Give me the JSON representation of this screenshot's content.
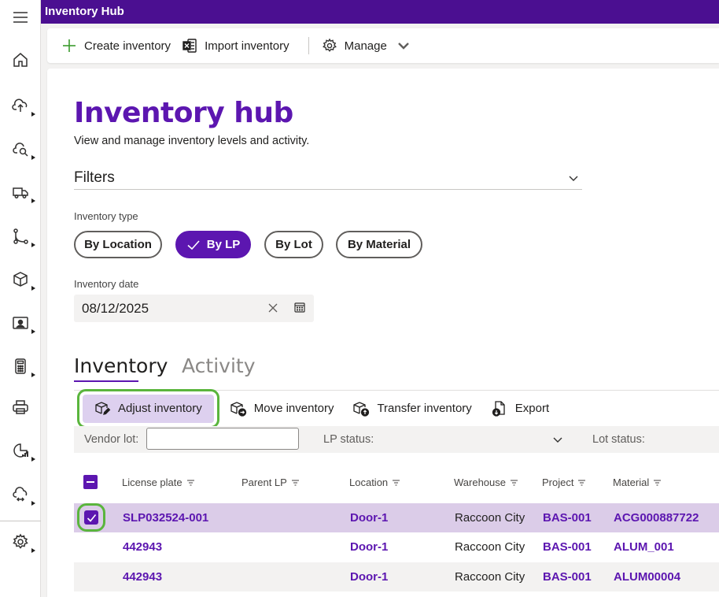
{
  "app": {
    "title": "Inventory Hub"
  },
  "rail": {
    "items": [
      {
        "icon": "hamburger-menu-icon"
      },
      {
        "icon": "home-icon"
      },
      {
        "icon": "upload-icon"
      },
      {
        "icon": "cloud-search-icon"
      },
      {
        "icon": "truck-icon"
      },
      {
        "icon": "workflow-icon"
      },
      {
        "icon": "box-icon"
      },
      {
        "icon": "contact-card-icon"
      },
      {
        "icon": "calculator-icon"
      },
      {
        "icon": "printer-icon"
      },
      {
        "icon": "analytics-icon"
      },
      {
        "icon": "cloud-sync-icon"
      },
      {
        "icon": "settings-icon"
      }
    ]
  },
  "commandbar": {
    "create_label": "Create inventory",
    "import_label": "Import inventory",
    "manage_label": "Manage"
  },
  "page": {
    "title": "Inventory hub",
    "subtitle": "View and manage inventory levels and activity.",
    "filters_label": "Filters"
  },
  "inventory_type": {
    "label": "Inventory type",
    "options": [
      "By Location",
      "By LP",
      "By Lot",
      "By Material"
    ],
    "selected": "By LP"
  },
  "inventory_date": {
    "label": "Inventory date",
    "value": "08/12/2025"
  },
  "tabs": {
    "inventory": "Inventory",
    "activity": "Activity",
    "active": "Inventory"
  },
  "actions": {
    "adjust": "Adjust inventory",
    "move": "Move inventory",
    "transfer": "Transfer inventory",
    "export": "Export"
  },
  "filter_row": {
    "vendor_lot_label": "Vendor lot:",
    "vendor_lot_value": "",
    "lp_status_label": "LP status:",
    "lot_status_label": "Lot status:"
  },
  "table": {
    "columns": [
      "License plate",
      "Parent LP",
      "Location",
      "Warehouse",
      "Project",
      "Material"
    ],
    "rows": [
      {
        "license_plate": "SLP032524-001",
        "parent_lp": "",
        "location": "Door-1",
        "warehouse": "Raccoon City",
        "project": "BAS-001",
        "material": "ACG000887722",
        "selected": true
      },
      {
        "license_plate": "442943",
        "parent_lp": "",
        "location": "Door-1",
        "warehouse": "Raccoon City",
        "project": "BAS-001",
        "material": "ALUM_001",
        "selected": false
      },
      {
        "license_plate": "442943",
        "parent_lp": "",
        "location": "Door-1",
        "warehouse": "Raccoon City",
        "project": "BAS-001",
        "material": "ALUM00004",
        "selected": false
      }
    ]
  },
  "colors": {
    "brand": "#4b0f91",
    "accent": "#5c16b0",
    "selected_row": "#dbcce8",
    "highlight_outline": "#5ab53d"
  }
}
